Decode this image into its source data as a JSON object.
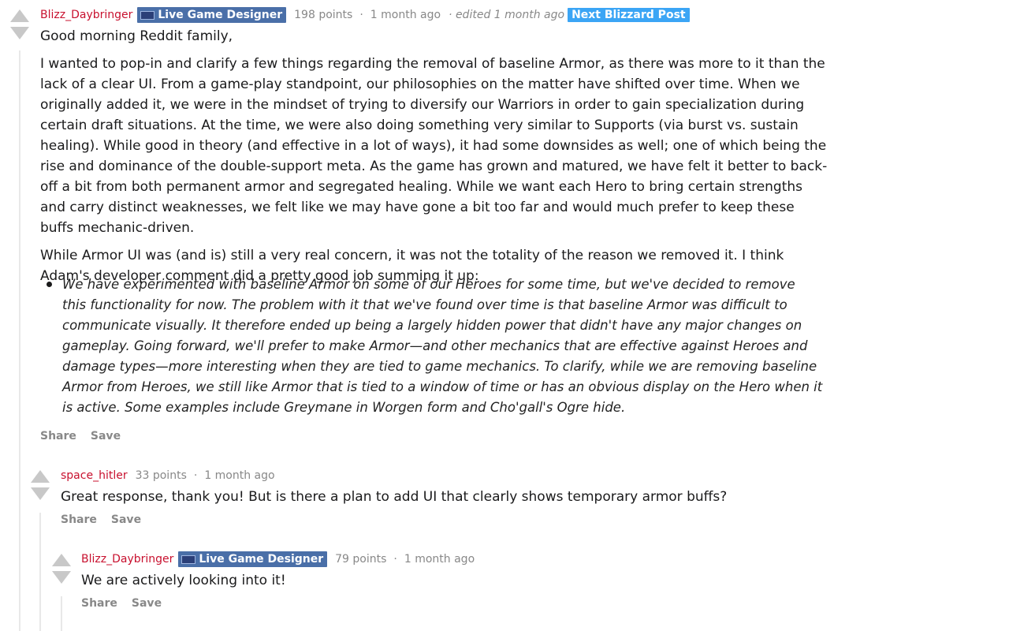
{
  "comments": [
    {
      "author": "Blizz_Daybringer",
      "flair": "Live Game Designer",
      "points": "198 points",
      "sep": "·",
      "time": "1 month ago",
      "edited": "· edited 1 month ago",
      "next_post": "Next Blizzard Post",
      "paragraphs": [
        "Good morning Reddit family,",
        "I wanted to pop-in and clarify a few things regarding the removal of baseline Armor, as there was more to it than the lack of a clear UI. From a game-play standpoint, our philosophies on the matter have shifted over time. When we originally added it, we were in the mindset of trying to diversify our Warriors in order to gain specialization during certain draft situations. At the time, we were also doing something very similar to Supports (via burst vs. sustain healing). While good in theory (and effective in a lot of ways), it had some downsides as well; one of which being the rise and dominance of the double-support meta. As the game has grown and matured, we have felt it better to back-off a bit from both permanent armor and segregated healing. While we want each Hero to bring certain strengths and carry distinct weaknesses, we felt like we may have gone a bit too far and would much prefer to keep these buffs mechanic-driven.",
        "While Armor UI was (and is) still a very real concern, it was not the totality of the reason we removed it. I think Adam's developer comment did a pretty good job summing it up:"
      ],
      "quote": "We have experimented with baseline Armor on some of our Heroes for some time, but we've decided to remove this functionality for now. The problem with it that we've found over time is that baseline Armor was difficult to communicate visually. It therefore ended up being a largely hidden power that didn't have any major changes on gameplay. Going forward, we'll prefer to make Armor—and other mechanics that are effective against Heroes and damage types—more interesting when they are tied to game mechanics. To clarify, while we are removing baseline Armor from Heroes, we still like Armor that is tied to a window of time or has an obvious display on the Hero when it is active. Some examples include Greymane in Worgen form and Cho'gall's Ogre hide.",
      "share": "Share",
      "save": "Save"
    },
    {
      "author": "space_hitler",
      "points": "33 points",
      "sep": "·",
      "time": "1 month ago",
      "body": "Great response, thank you! But is there a plan to add UI that clearly shows temporary armor buffs?",
      "share": "Share",
      "save": "Save"
    },
    {
      "author": "Blizz_Daybringer",
      "flair": "Live Game Designer",
      "points": "79 points",
      "sep": "·",
      "time": "1 month ago",
      "body": "We are actively looking into it!",
      "share": "Share",
      "save": "Save"
    }
  ]
}
